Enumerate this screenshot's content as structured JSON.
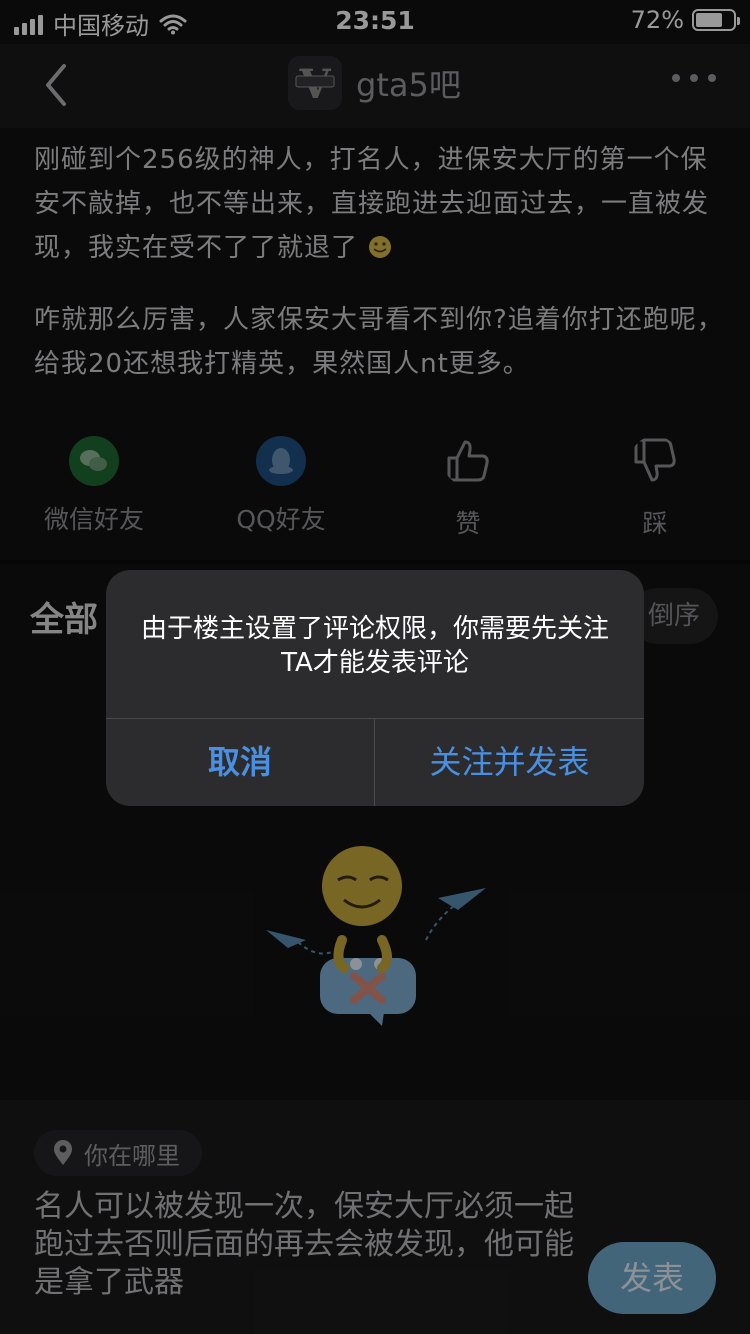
{
  "status_bar": {
    "carrier": "中国移动",
    "time": "23:51",
    "battery": "72%",
    "battery_level": 0.72
  },
  "nav": {
    "forum_name": "gta5吧",
    "avatar_text": "V"
  },
  "post": {
    "paragraph1": "刚碰到个256级的神人，打名人，进保安大厅的第一个保安不敲掉，也不等出来，直接跑进去迎面过去，一直被发现，我实在受不了了就退了",
    "paragraph2": "咋就那么厉害，人家保安大哥看不到你?追着你打还跑呢，给我20还想我打精英，果然国人nt更多。"
  },
  "share": {
    "wechat": "微信好友",
    "qq": "QQ好友",
    "like": "赞",
    "dislike": "踩"
  },
  "comments": {
    "tab_all": "全部",
    "sort_label": "倒序"
  },
  "dialog": {
    "message": "由于楼主设置了评论权限，你需要先关注TA才能发表评论",
    "cancel": "取消",
    "confirm": "关注并发表"
  },
  "composer": {
    "location": "你在哪里",
    "draft_text": "名人可以被发现一次，保安大厅必须一起跑过去否则后面的再去会被发现，他可能是拿了武器",
    "send": "发表"
  },
  "colors": {
    "accent": "#4a90e2",
    "send_button": "#6fa8cc"
  }
}
